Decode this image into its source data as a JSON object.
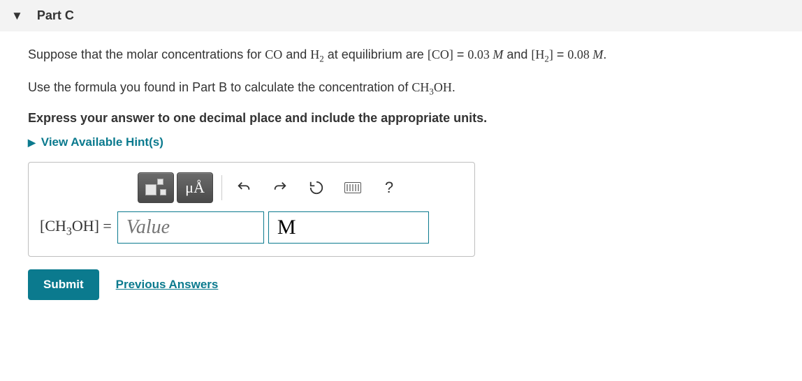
{
  "part": {
    "label": "Part C"
  },
  "question": {
    "line1_prefix": "Suppose that the molar concentrations for ",
    "sp1": "CO",
    "mid1": " and ",
    "sp2_base": "H",
    "sp2_sub": "2",
    "mid2": " at equilibrium are ",
    "eq1_lhs": "[CO]",
    "eq1_eq": " = ",
    "eq1_val": "0.03",
    "unit_M": " M",
    "and": " and ",
    "eq2_lhs_pre": "[H",
    "eq2_lhs_sub": "2",
    "eq2_lhs_post": "]",
    "eq2_eq": " = ",
    "eq2_val": "0.08",
    "period": ".",
    "line2_prefix": "Use the formula you found in Part B to calculate the concentration of ",
    "target_base": "CH",
    "target_sub": "3",
    "target_suffix": "OH",
    "instruction": "Express your answer to one decimal place and include the appropriate units."
  },
  "hints": {
    "label": "View Available Hint(s)"
  },
  "toolbar": {
    "templates_title": "Templates",
    "symbols_label": "μÅ",
    "help": "?"
  },
  "answer": {
    "lhs_pre": "[CH",
    "lhs_sub": "3",
    "lhs_post": "OH]",
    "equals": " = ",
    "value_placeholder": "Value",
    "unit_value": "M"
  },
  "buttons": {
    "submit": "Submit",
    "previous": "Previous Answers"
  }
}
